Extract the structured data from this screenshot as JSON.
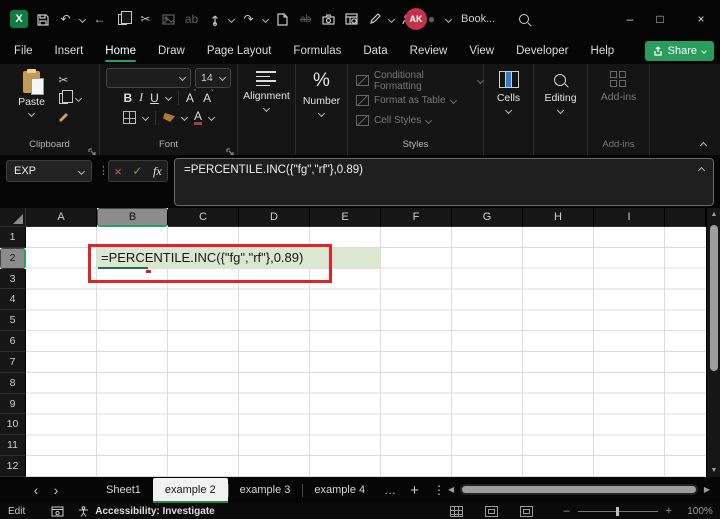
{
  "icons": {
    "logo": "X",
    "cut": "✂",
    "undo": "↶",
    "redo": "↷",
    "back": "←",
    "kebab": "⋮",
    "ellipsis": "…",
    "plus": "+",
    "nav_left": "‹",
    "nav_right": "›",
    "minimize": "–",
    "maximize": "□",
    "close": "×",
    "cancel": "×",
    "check": "✓",
    "fx": "fx",
    "percent": "%",
    "record": "●",
    "bold": "B",
    "italic": "I",
    "underline": "U",
    "grow": "A",
    "shrink": "A",
    "grow_mark": "ˆ",
    "shrink_mark": "ˇ",
    "up": "▲",
    "down": "▼",
    "left": "◀",
    "right": "▶",
    "ab_replace": "ab"
  },
  "titlebar": {
    "title": "Book...",
    "avatar": "AK"
  },
  "menu": {
    "items": [
      "File",
      "Insert",
      "Home",
      "Draw",
      "Page Layout",
      "Formulas",
      "Data",
      "Review",
      "View",
      "Developer",
      "Help"
    ],
    "active": "Home",
    "share": "Share"
  },
  "ribbon": {
    "paste": "Paste",
    "clipboard_group": "Clipboard",
    "font_size": "14",
    "font_group": "Font",
    "alignment": "Alignment",
    "number_group": "Number",
    "styles": {
      "conditional": "Conditional Formatting",
      "format_table": "Format as Table",
      "cell_styles": "Cell Styles",
      "group": "Styles"
    },
    "cells": "Cells",
    "editing": "Editing",
    "addins": "Add-ins",
    "addins_group": "Add-ins"
  },
  "formula_bar": {
    "name_box": "EXP",
    "formula": "=PERCENTILE.INC({\"fg\",\"rf\"},0.89)"
  },
  "grid": {
    "columns": [
      "A",
      "B",
      "C",
      "D",
      "E",
      "F",
      "G",
      "H",
      "I"
    ],
    "rows": [
      "1",
      "2",
      "3",
      "4",
      "5",
      "6",
      "7",
      "8",
      "9",
      "10",
      "11",
      "12"
    ],
    "active_cell": "B2",
    "cell_text": "=PERCENTILE.INC({\"fg\",\"rf\"},0.89)"
  },
  "sheet_bar": {
    "tabs": [
      "Sheet1",
      "example 2",
      "example 3",
      "example 4"
    ],
    "active": "example 2"
  },
  "status_bar": {
    "mode": "Edit",
    "accessibility": "Accessibility: Investigate",
    "zoom": "100%"
  },
  "colors": {
    "accent_green": "#21a366",
    "share_green": "#2a9d5c",
    "selection_fill": "#dbe7d0",
    "annotation_red": "#df2426",
    "avatar_red": "#c4314b"
  }
}
